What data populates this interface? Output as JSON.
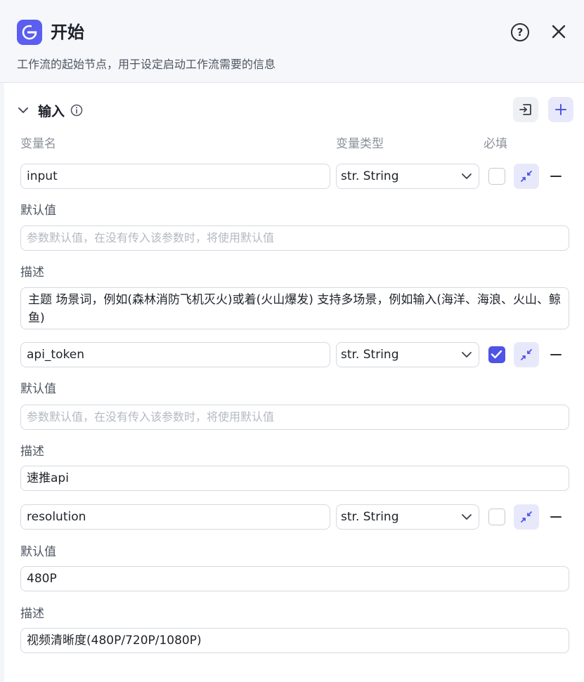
{
  "header": {
    "title": "开始",
    "subtitle": "工作流的起始节点，用于设定启动工作流需要的信息"
  },
  "section": {
    "title": "输入"
  },
  "columns": {
    "name": "变量名",
    "type": "变量类型",
    "required": "必填"
  },
  "labels": {
    "default_value": "默认值",
    "description": "描述"
  },
  "variables": [
    {
      "name": "input",
      "type": "str. String",
      "required": false,
      "default_placeholder": "参数默认值，在没有传入该参数时，将使用默认值",
      "default_value": "",
      "description": "主题 场景词，例如(森林消防飞机灭火)或着(火山爆发) 支持多场景，例如输入(海洋、海浪、火山、鲸鱼)"
    },
    {
      "name": "api_token",
      "type": "str. String",
      "required": true,
      "default_placeholder": "参数默认值，在没有传入该参数时，将使用默认值",
      "default_value": "",
      "description": "速推api"
    },
    {
      "name": "resolution",
      "type": "str. String",
      "required": false,
      "default_placeholder": "",
      "default_value": "480P",
      "description": "视频清晰度(480P/720P/1080P)"
    }
  ],
  "icons": {
    "logo": "start-node-icon",
    "help": "help-circle-icon",
    "close": "close-icon",
    "chevron": "chevron-down-icon",
    "info": "info-icon",
    "import": "import-icon",
    "add": "plus-icon",
    "collapse": "collapse-icon",
    "remove": "minus-icon"
  },
  "colors": {
    "accent": "#5b5ef0",
    "accent_light": "#e7e9fb",
    "header_bg": "#f6f7fb"
  }
}
